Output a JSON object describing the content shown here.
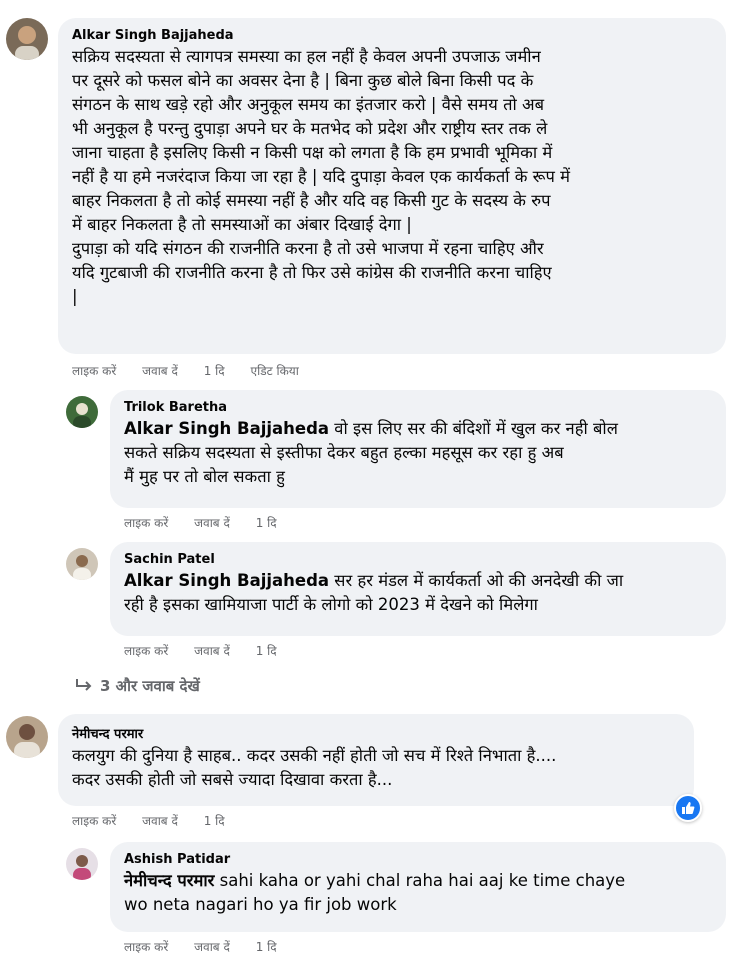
{
  "comments": [
    {
      "author": "Alkar Singh Bajjaheda",
      "lines": [
        "सक्रिय सदस्यता से त्यागपत्र समस्या का हल नहीं है केवल अपनी उपजाऊ जमीन",
        "पर दूसरे को फसल बोने का अवसर देना है | बिना कुछ बोले बिना किसी पद के",
        "संगठन के साथ खड़े रहो और अनुकूल समय का इंतजार करो | वैसे समय तो अब",
        "भी अनुकूल है परन्तु दुपाड़ा अपने घर के मतभेद को प्रदेश और राष्ट्रीय स्तर तक ले",
        "जाना चाहता है इसलिए किसी न किसी पक्ष को लगता है कि हम प्रभावी भूमिका में",
        "नहीं है या हमे नजरंदाज किया जा रहा है | यदि दुपाड़ा केवल एक कार्यकर्ता के रूप में",
        "बाहर निकलता है तो कोई समस्या नहीं है और यदि वह किसी गुट के सदस्य के रुप",
        "में बाहर निकलता है तो समस्याओं का अंबार दिखाई देगा |",
        "दुपाड़ा को यदि संगठन की राजनीति करना है तो उसे भाजपा में रहना चाहिए और",
        "यदि गुटबाजी की राजनीति करना है तो फिर उसे कांग्रेस की राजनीति करना चाहिए",
        "|"
      ],
      "like": "लाइक करें",
      "reply": "जवाब दें",
      "time": "1 दि",
      "edited": "एडिट किया"
    },
    {
      "author": "Trilok Baretha",
      "mention": "Alkar Singh Bajjaheda",
      "lines": [
        "वो इस लिए सर की बंदिशों में खुल कर नही बोल",
        "सकते सक्रिय सदस्यता से इस्तीफा देकर बहुत हल्का महसूस कर रहा हु अब",
        "मैं मुह पर तो बोल सकता हु"
      ],
      "like": "लाइक करें",
      "reply": "जवाब दें",
      "time": "1 दि"
    },
    {
      "author": "Sachin Patel",
      "mention": "Alkar Singh Bajjaheda",
      "lines": [
        "सर हर मंडल में कार्यकर्ता ओ की अनदेखी की जा",
        "रही है इसका खामियाजा पार्टी के लोगो को 2023 में देखने को मिलेगा"
      ],
      "like": "लाइक करें",
      "reply": "जवाब दें",
      "time": "1 दि"
    },
    {
      "author": "नेमीचन्द परमार",
      "lines": [
        "कलयुग की दुनिया है साहब.. कदर उसकी नहीं होती जो सच में रिश्ते निभाता है....",
        "कदर उसकी होती जो सबसे ज्यादा दिखावा करता है..."
      ],
      "like": "लाइक करें",
      "reply": "जवाब दें",
      "time": "1 दि"
    },
    {
      "author": "Ashish Patidar",
      "mention": "नेमीचन्द परमार",
      "lines": [
        "sahi kaha or yahi chal raha hai aaj ke time chaye",
        "wo neta nagari ho ya fir job work"
      ],
      "like": "लाइक करें",
      "reply": "जवाब दें",
      "time": "1 दि"
    }
  ],
  "more_replies": "3 और जवाब देखें",
  "reaction_icon": "like-reaction-icon",
  "colors": {
    "bubble": "#f0f2f5",
    "meta": "#65676b",
    "accent": "#1877f2"
  }
}
